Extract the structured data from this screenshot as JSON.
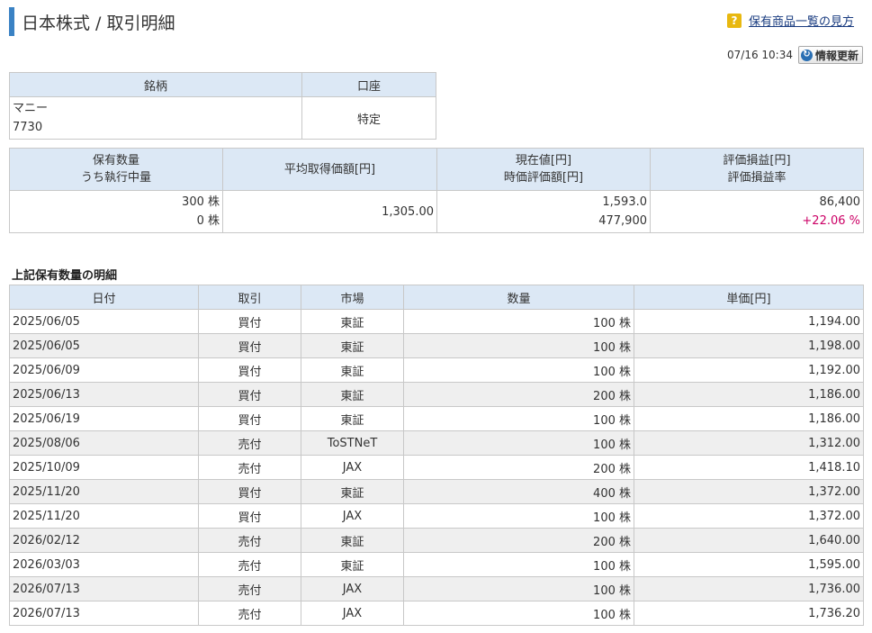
{
  "header": {
    "title": "日本株式 / 取引明細",
    "help_link": "保有商品一覧の見方",
    "timestamp": "07/16 10:34",
    "update_button": "情報更新"
  },
  "security": {
    "headers": [
      "銘柄",
      "口座"
    ],
    "name": "マニー",
    "code": "7730",
    "account": "特定"
  },
  "summary": {
    "headers": [
      [
        "保有数量",
        "うち執行中量"
      ],
      [
        "平均取得価額[円]"
      ],
      [
        "現在値[円]",
        "時価評価額[円]"
      ],
      [
        "評価損益[円]",
        "評価損益率"
      ]
    ],
    "holding_qty": "300 株",
    "executing_qty": "0 株",
    "avg_price": "1,305.00",
    "current_price": "1,593.0",
    "market_value": "477,900",
    "pl": "86,400",
    "pl_rate": "+22.06 %"
  },
  "details": {
    "section_title": "上記保有数量の明細",
    "headers": [
      "日付",
      "取引",
      "市場",
      "数量",
      "単価[円]"
    ],
    "rows": [
      [
        "2025/06/05",
        "買付",
        "東証",
        "100 株",
        "1,194.00"
      ],
      [
        "2025/06/05",
        "買付",
        "東証",
        "100 株",
        "1,198.00"
      ],
      [
        "2025/06/09",
        "買付",
        "東証",
        "100 株",
        "1,192.00"
      ],
      [
        "2025/06/13",
        "買付",
        "東証",
        "200 株",
        "1,186.00"
      ],
      [
        "2025/06/19",
        "買付",
        "東証",
        "100 株",
        "1,186.00"
      ],
      [
        "2025/08/06",
        "売付",
        "ToSTNeT",
        "100 株",
        "1,312.00"
      ],
      [
        "2025/10/09",
        "売付",
        "JAX",
        "200 株",
        "1,418.10"
      ],
      [
        "2025/11/20",
        "買付",
        "東証",
        "400 株",
        "1,372.00"
      ],
      [
        "2025/11/20",
        "買付",
        "JAX",
        "100 株",
        "1,372.00"
      ],
      [
        "2026/02/12",
        "売付",
        "東証",
        "200 株",
        "1,640.00"
      ],
      [
        "2026/03/03",
        "売付",
        "東証",
        "100 株",
        "1,595.00"
      ],
      [
        "2026/07/13",
        "売付",
        "JAX",
        "100 株",
        "1,736.00"
      ],
      [
        "2026/07/13",
        "売付",
        "JAX",
        "100 株",
        "1,736.20"
      ]
    ]
  },
  "colors": {
    "accent": "#3a82c4",
    "header_bg": "#dce8f5",
    "positive": "#cc0066",
    "help_icon": "#e8b810"
  }
}
